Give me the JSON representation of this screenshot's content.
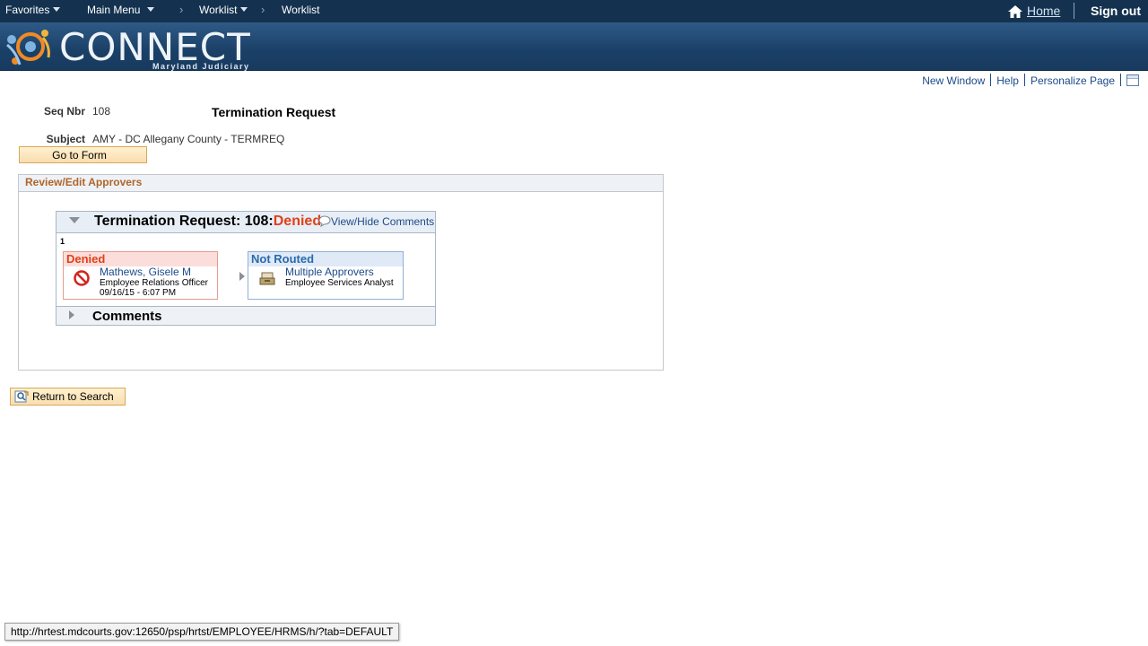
{
  "topnav": {
    "favorites": "Favorites",
    "main_menu": "Main Menu",
    "worklist_menu": "Worklist",
    "worklist": "Worklist",
    "home": "Home",
    "sign_out": "Sign out"
  },
  "banner": {
    "brand": "CONNECT",
    "tagline": "Maryland Judiciary"
  },
  "page_links": {
    "new_window": "New Window",
    "help": "Help",
    "personalize": "Personalize Page"
  },
  "form": {
    "seq_label": "Seq Nbr",
    "seq_value": "108",
    "title": "Termination Request",
    "subject_label": "Subject",
    "subject_value": "AMY - DC Allegany County - TERMREQ",
    "go_to_form": "Go to Form"
  },
  "group": {
    "title": "Review/Edit Approvers"
  },
  "approval": {
    "title": "Termination Request: 108:",
    "status": "Denied",
    "view_hide": "View/Hide Comments",
    "step_number": "1",
    "steps": [
      {
        "status": "Denied",
        "name": "Mathews, Gisele M",
        "role": "Employee Relations Officer",
        "timestamp": "09/16/15 - 6:07 PM"
      },
      {
        "status": "Not Routed",
        "name": "Multiple Approvers",
        "role": "Employee Services Analyst"
      }
    ],
    "comments": "Comments"
  },
  "return_to_search": "Return to Search",
  "status_bar": "http://hrtest.mdcourts.gov:12650/psp/hrtst/EMPLOYEE/HRMS/h/?tab=DEFAULT",
  "colors": {
    "nav_bg": "#14324f",
    "denied": "#e0401a",
    "link": "#1c4a8a",
    "group_title": "#b0652a"
  }
}
